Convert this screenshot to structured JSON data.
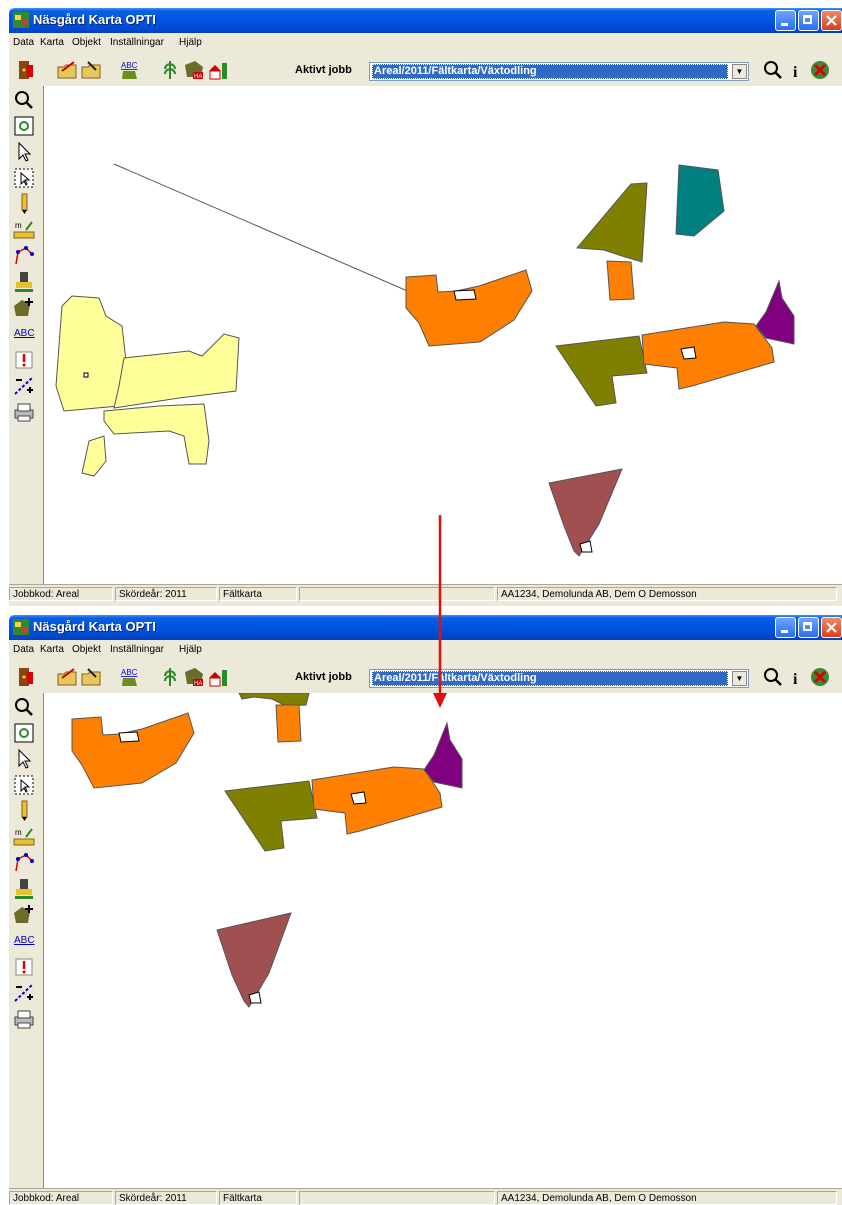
{
  "window": {
    "title": "Näsgård Karta OPTI"
  },
  "menubar": {
    "items": [
      "Data",
      "Karta",
      "Objekt",
      "Inställningar",
      "Hjälp"
    ]
  },
  "toolbar": {
    "active_job_label": "Aktivt jobb",
    "active_job_value": "Areal/2011/Fältkarta/Växtodling",
    "icons": [
      "exit-icon",
      "open-folder-icon",
      "save-folder-icon",
      "label-abc-icon",
      "crop-icon",
      "field-ha-icon",
      "farm-icon",
      "zoom-icon",
      "info-icon",
      "close-map-icon"
    ]
  },
  "left_tools": [
    "zoom-icon",
    "refresh-icon",
    "pointer-icon",
    "select-area-icon",
    "pencil-icon",
    "measure-icon",
    "edit-vertex-icon",
    "stamp-icon",
    "add-field-icon",
    "abc-text-icon",
    "marker-icon",
    "split-line-icon",
    "print-icon"
  ],
  "left_tool_abc_text": "ABC",
  "statusbar": {
    "jobbkod": "Jobbkod: Areal",
    "skordear": "Skördeår: 2011",
    "karta": "Fältkarta",
    "empty": "",
    "owner": "AA1234, Demolunda AB, Dem O Demosson"
  },
  "colors": {
    "orange": "#ff8000",
    "olive": "#808000",
    "teal": "#008080",
    "purple": "#800080",
    "brown": "#a05050",
    "yellow": "#ffff99",
    "arrow": "#e01010"
  }
}
